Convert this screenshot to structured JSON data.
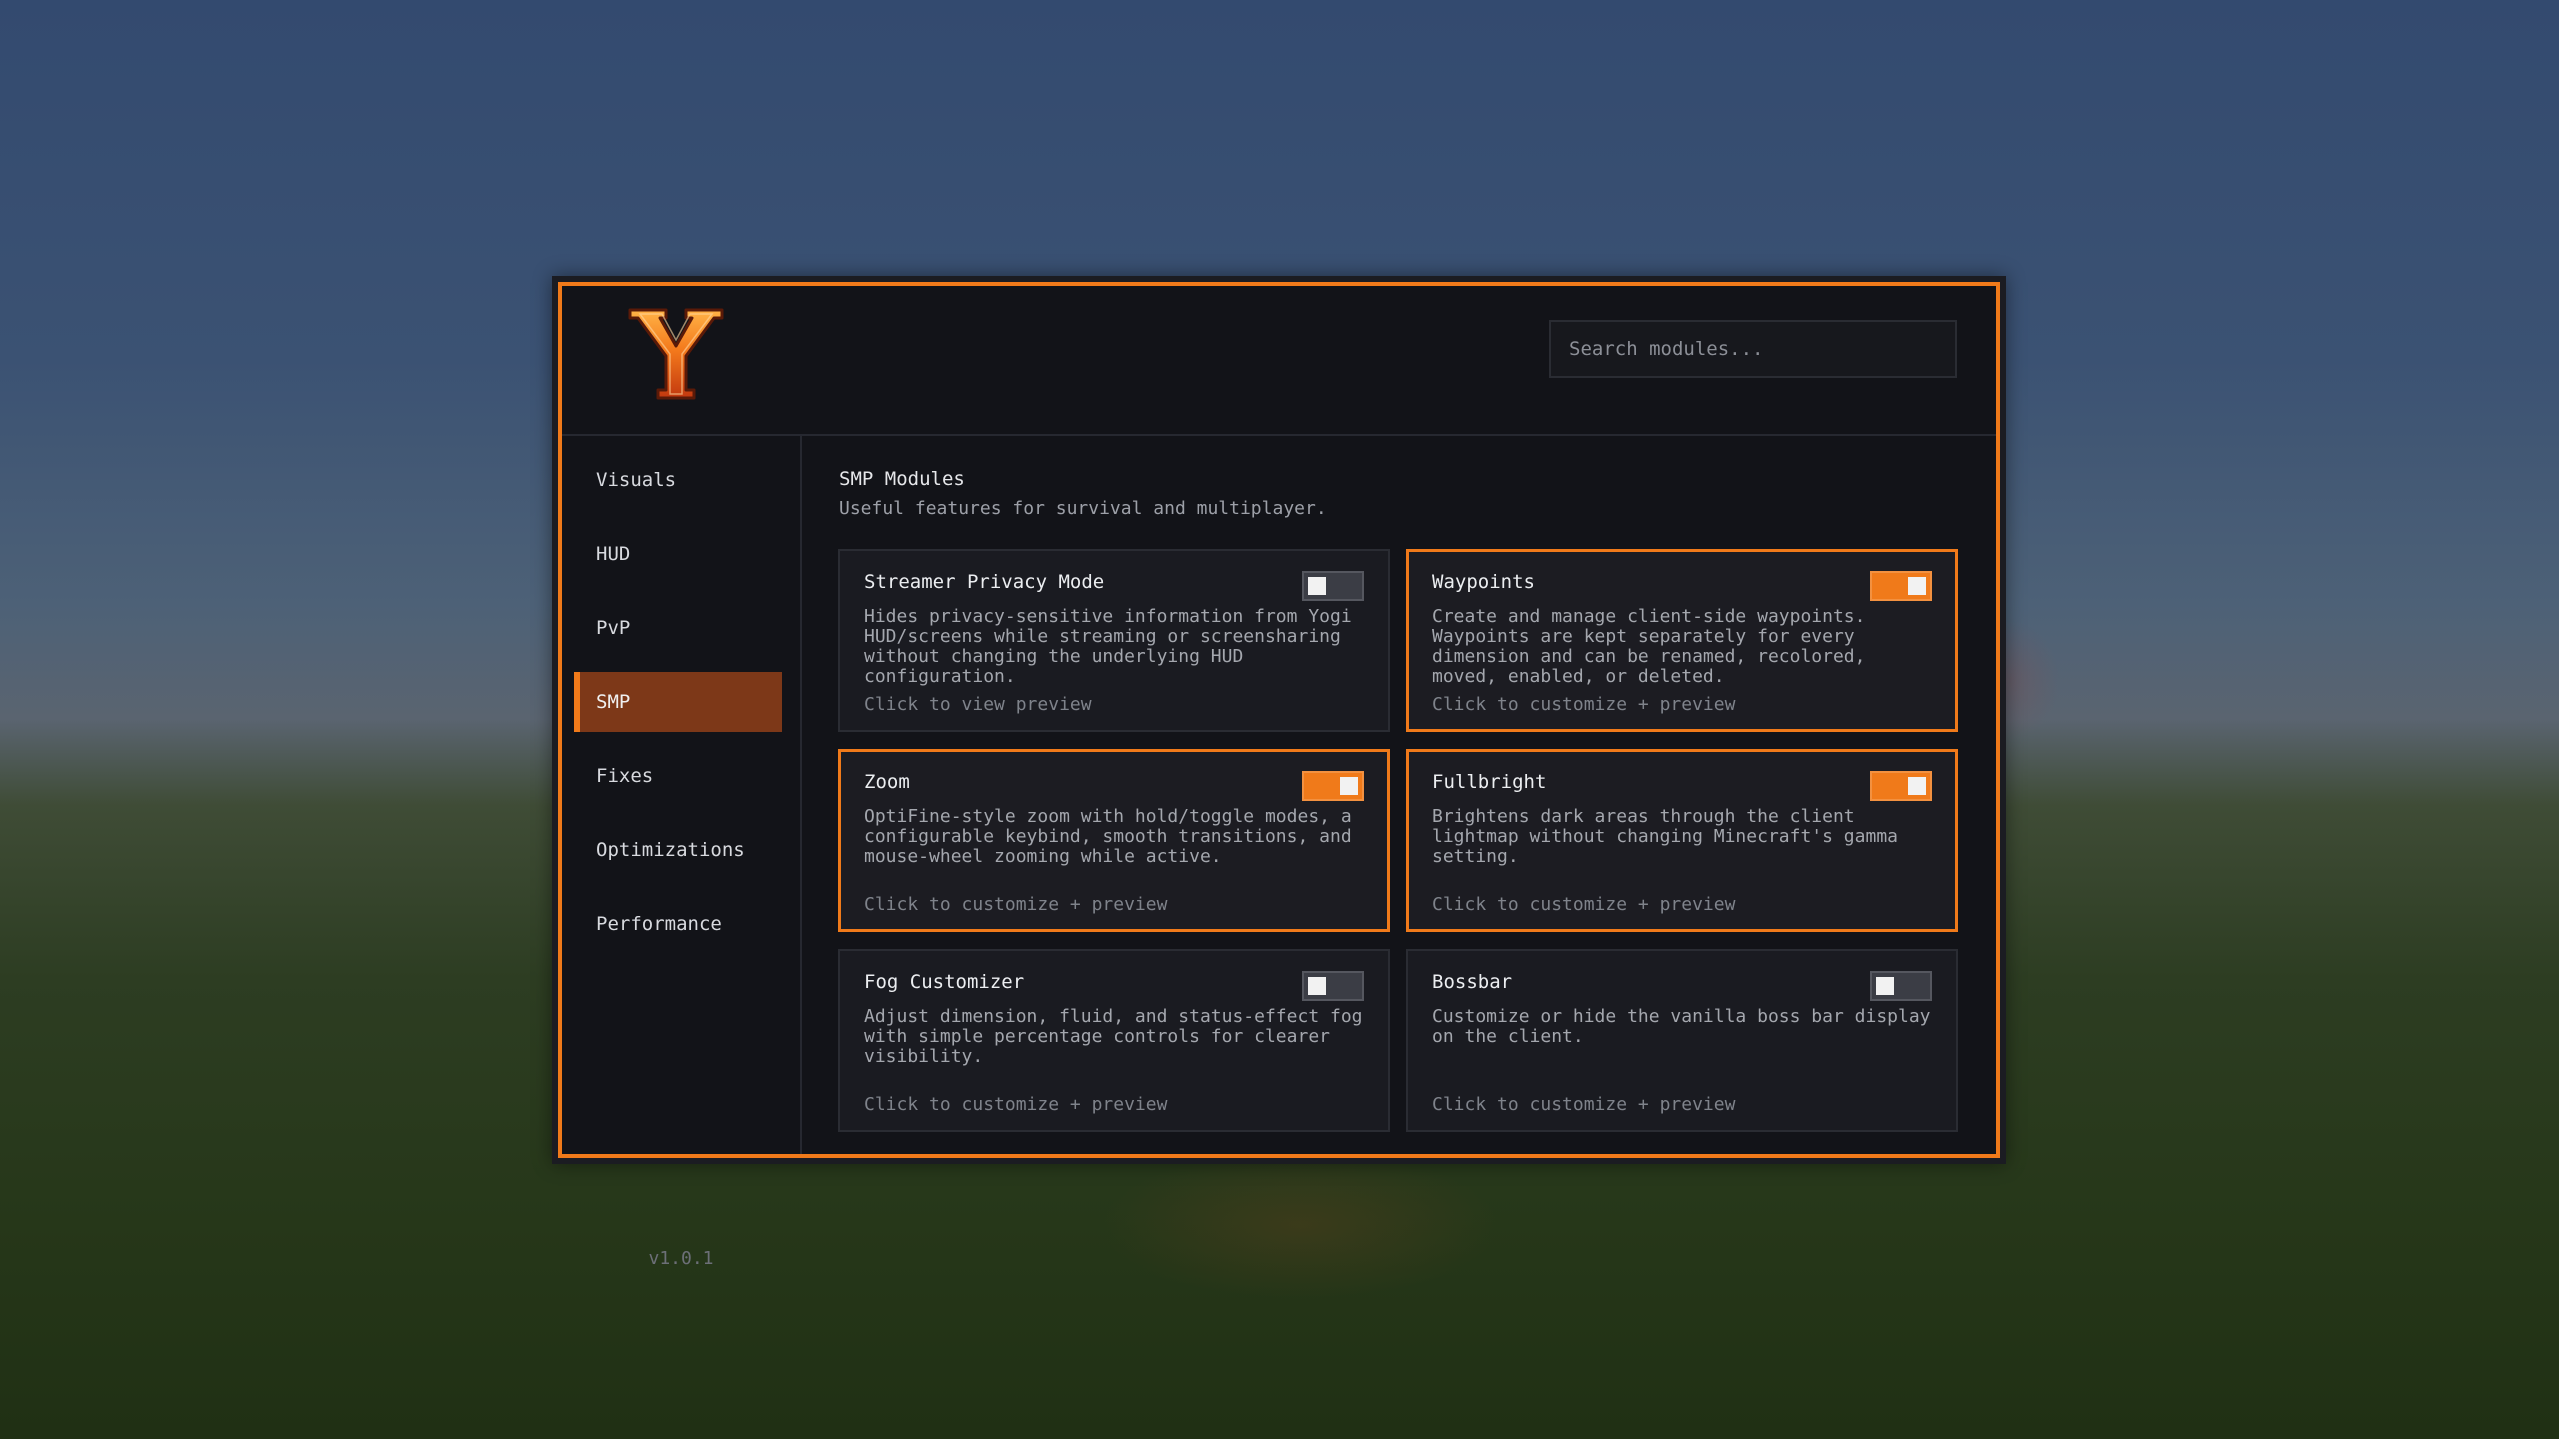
{
  "app": {
    "logo_letter": "Y",
    "search_placeholder": "Search modules...",
    "version": "v1.0.1",
    "accent_color": "#f07a1a"
  },
  "sidebar": {
    "items": [
      {
        "label": "Visuals",
        "active": false
      },
      {
        "label": "HUD",
        "active": false
      },
      {
        "label": "PvP",
        "active": false
      },
      {
        "label": "SMP",
        "active": true
      },
      {
        "label": "Fixes",
        "active": false
      },
      {
        "label": "Optimizations",
        "active": false
      },
      {
        "label": "Performance",
        "active": false
      }
    ]
  },
  "main": {
    "title": "SMP Modules",
    "subtitle": "Useful features for survival and multiplayer.",
    "modules": [
      {
        "title": "Streamer Privacy Mode",
        "description": "Hides privacy-sensitive information from Yogi HUD/screens while streaming or screensharing without changing the underlying HUD configuration.",
        "footer": "Click to view preview",
        "enabled": false
      },
      {
        "title": "Waypoints",
        "description": "Create and manage client-side waypoints. Waypoints are kept separately for every dimension and can be renamed, recolored, moved, enabled, or deleted.",
        "footer": "Click to customize + preview",
        "enabled": true
      },
      {
        "title": "Zoom",
        "description": "OptiFine-style zoom with hold/toggle modes, a configurable keybind, smooth transitions, and mouse-wheel zooming while active.",
        "footer": "Click to customize + preview",
        "enabled": true
      },
      {
        "title": "Fullbright",
        "description": "Brightens dark areas through the client lightmap without changing Minecraft's gamma setting.",
        "footer": "Click to customize + preview",
        "enabled": true
      },
      {
        "title": "Fog Customizer",
        "description": "Adjust dimension, fluid, and status-effect fog with simple percentage controls for clearer visibility.",
        "footer": "Click to customize + preview",
        "enabled": false
      },
      {
        "title": "Bossbar",
        "description": "Customize or hide the vanilla boss bar display on the client.",
        "footer": "Click to customize + preview",
        "enabled": false
      }
    ]
  }
}
